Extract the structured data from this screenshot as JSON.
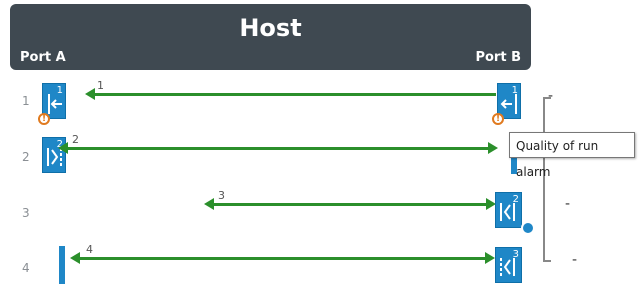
{
  "host": {
    "title": "Host",
    "port_a": "Port A",
    "port_b": "Port B"
  },
  "rows": [
    {
      "num": "1",
      "link_label": "1",
      "left_tile_num": "1",
      "right_tile_num": "1"
    },
    {
      "num": "2",
      "link_label": "2",
      "left_tile_num": "2"
    },
    {
      "num": "3",
      "link_label": "3",
      "right_tile_num": "2"
    },
    {
      "num": "4",
      "link_label": "4",
      "right_tile_num": "3"
    }
  ],
  "tooltip": {
    "text": "Quality of run alarm"
  },
  "dashes": {
    "d1": "-",
    "d2": "-",
    "d3": "-",
    "d4": "-"
  },
  "colors": {
    "accent": "#1f87c7",
    "link": "#2b8f2b",
    "header": "#3f4951",
    "alarm": "#e07a1f"
  },
  "icons": [
    "port-tile-icon",
    "alarm-icon",
    "gear-icon",
    "arrow-icon"
  ]
}
